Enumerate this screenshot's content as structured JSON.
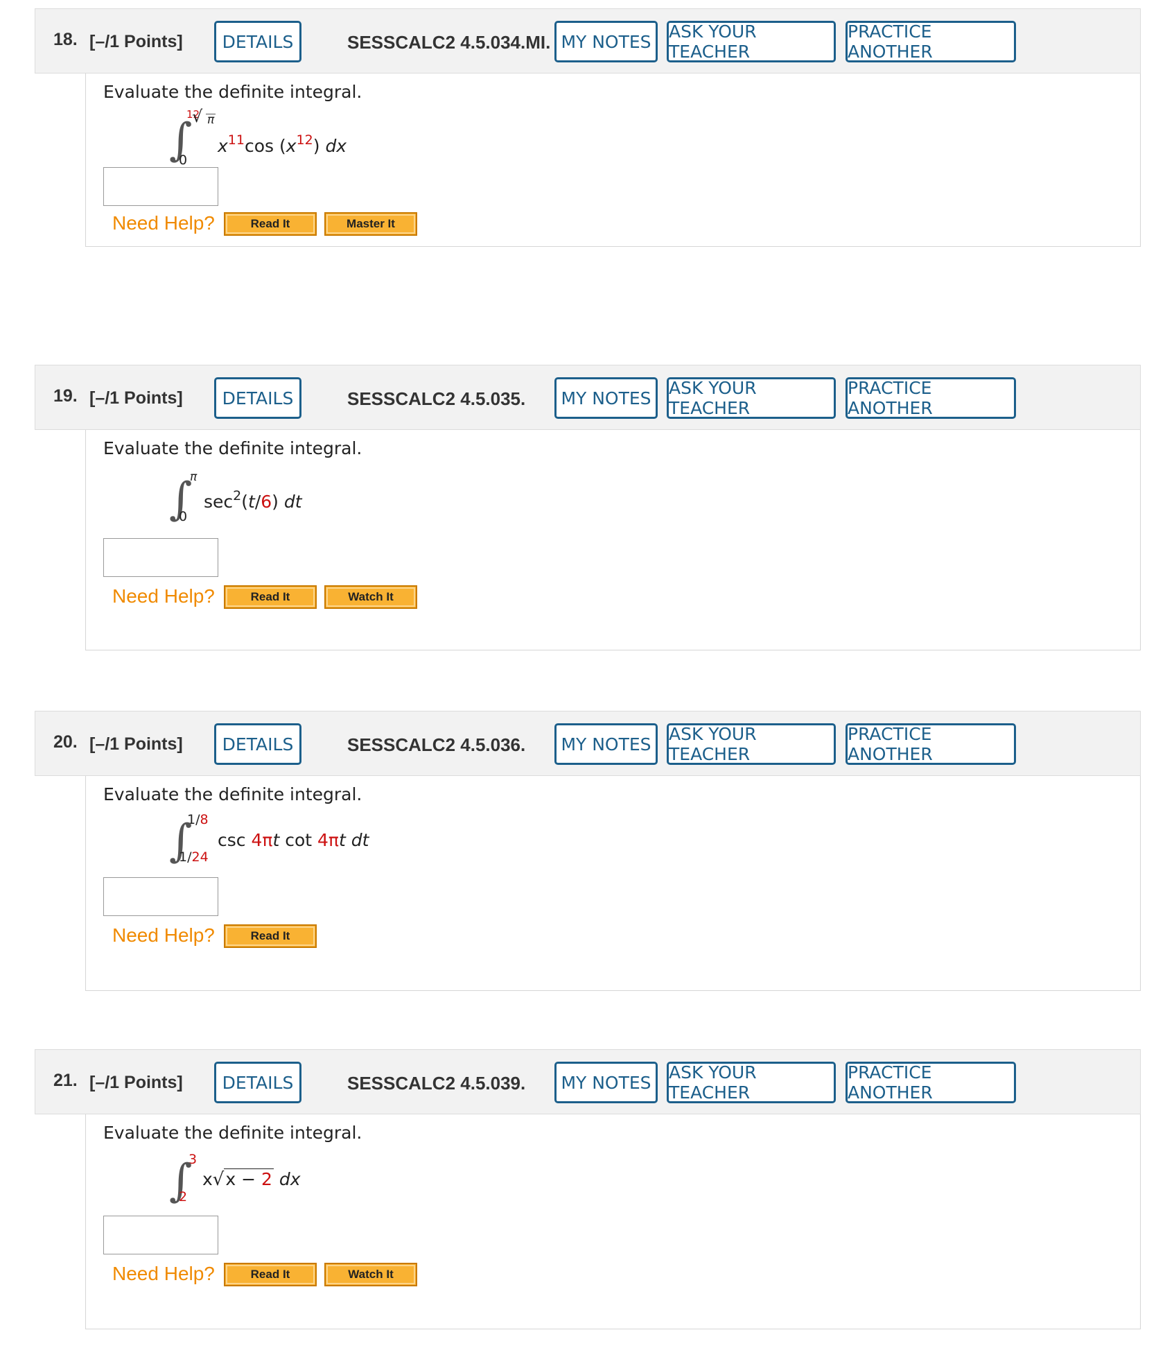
{
  "buttons": {
    "details": "DETAILS",
    "my_notes": "MY NOTES",
    "ask_teacher": "ASK YOUR TEACHER",
    "practice_another": "PRACTICE ANOTHER",
    "need_help": "Need Help?",
    "read_it": "Read It",
    "master_it": "Master It",
    "watch_it": "Watch It"
  },
  "questions": [
    {
      "number": "18.",
      "points": "[–/1 Points]",
      "code": "SESSCALC2 4.5.034.MI.",
      "prompt": "Evaluate the definite integral.",
      "upper_index": "12",
      "upper": "π",
      "lower": "0",
      "expr": {
        "x": "x",
        "p1": "11",
        "cos": "cos (",
        "x2": "x",
        "p2": "12",
        "end": ") ",
        "d": "dx"
      },
      "answer": ""
    },
    {
      "number": "19.",
      "points": "[–/1 Points]",
      "code": "SESSCALC2 4.5.035.",
      "prompt": "Evaluate the definite integral.",
      "upper": "π",
      "lower": "0",
      "expr": {
        "sec": "sec",
        "p": "2",
        "open": "(",
        "t": "t",
        "slash": "/",
        "den": "6",
        "close": ") ",
        "d": "dt"
      },
      "answer": ""
    },
    {
      "number": "20.",
      "points": "[–/1 Points]",
      "code": "SESSCALC2 4.5.036.",
      "prompt": "Evaluate the definite integral.",
      "upper_a": "1/",
      "upper_b": "8",
      "lower_a": "1/",
      "lower_b": "24",
      "expr": {
        "csc": "csc ",
        "k1": "4π",
        "t1": "t",
        "cot": " cot ",
        "k2": "4π",
        "t2": "t",
        "d": " dt"
      },
      "answer": ""
    },
    {
      "number": "21.",
      "points": "[–/1 Points]",
      "code": "SESSCALC2 4.5.039.",
      "prompt": "Evaluate the definite integral.",
      "upper": "3",
      "lower": "2",
      "expr": {
        "x": "x",
        "rad_x": "x − ",
        "rad_n": "2",
        "d": " dx"
      },
      "answer": ""
    }
  ]
}
